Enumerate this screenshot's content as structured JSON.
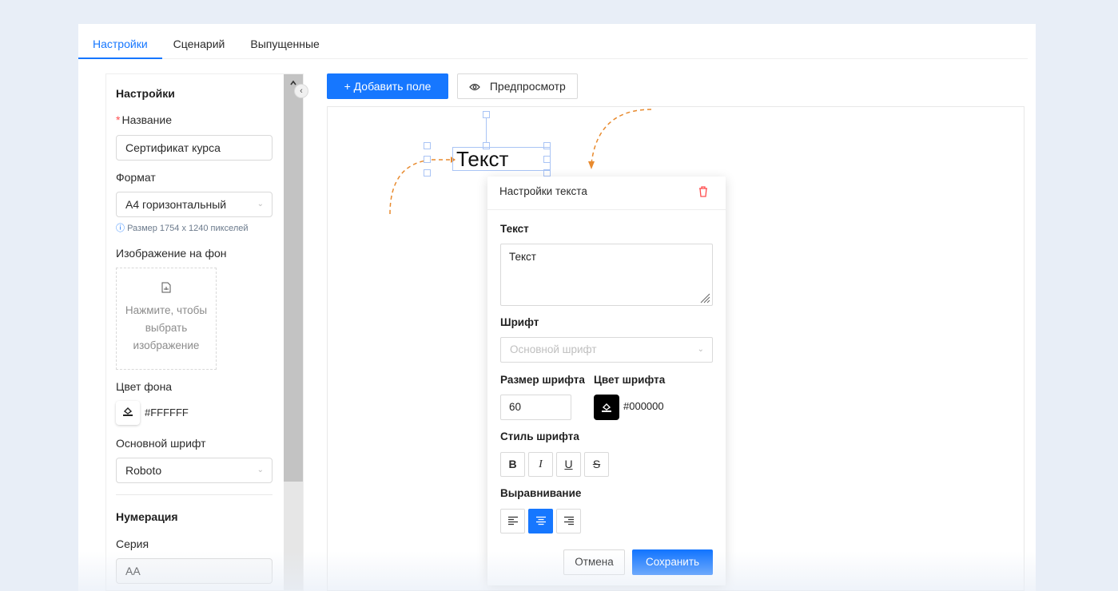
{
  "tabs": [
    "Настройки",
    "Сценарий",
    "Выпущенные"
  ],
  "left": {
    "section_title": "Настройки",
    "name_label": "Название",
    "name_required": "*",
    "name_value": "Сертификат курса",
    "format_label": "Формат",
    "format_value": "А4 горизонтальный",
    "format_hint": "Размер 1754 x 1240 пикселей",
    "bg_image_label": "Изображение на фон",
    "upload_text_1": "Нажмите, чтобы",
    "upload_text_2": "выбрать",
    "upload_text_3": "изображение",
    "bg_color_label": "Цвет фона",
    "bg_color_value": "#FFFFFF",
    "main_font_label": "Основной шрифт",
    "main_font_value": "Roboto",
    "numbering_title": "Нумерация",
    "series_label": "Серия",
    "series_value": "АА"
  },
  "toolbar": {
    "add_field": "Добавить поле",
    "preview": "Предпросмотр"
  },
  "canvas": {
    "text_element": "Текст"
  },
  "popup": {
    "title": "Настройки текста",
    "text_label": "Текст",
    "text_value": "Текст",
    "font_label": "Шрифт",
    "font_placeholder": "Основной шрифт",
    "font_size_label": "Размер шрифта",
    "font_size_value": "60",
    "font_color_label": "Цвет шрифта",
    "font_color_value": "#000000",
    "font_style_label": "Стиль шрифта",
    "style_buttons": [
      "B",
      "I",
      "U",
      "S"
    ],
    "align_label": "Выравнивание",
    "align_selected": "center",
    "cancel": "Отмена",
    "save": "Сохранить"
  },
  "colors": {
    "accent": "#1677ff",
    "danger": "#ff4d4f",
    "guide_orange": "#e88a2e"
  }
}
